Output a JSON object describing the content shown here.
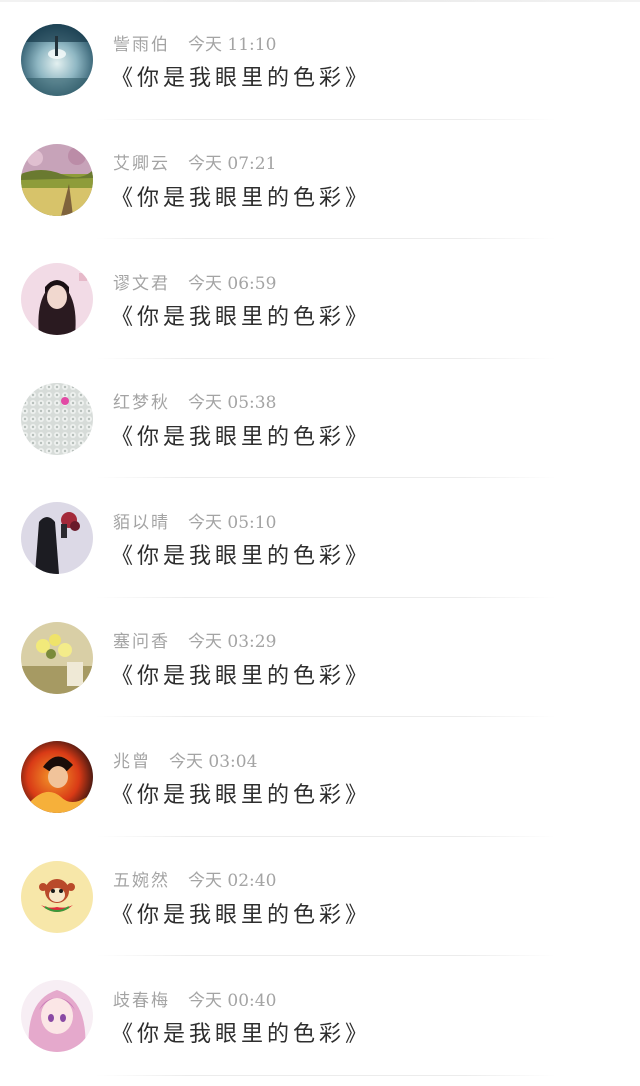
{
  "feed": {
    "items": [
      {
        "name": "訾雨伯",
        "date": "今天",
        "time": "11:10",
        "message": "《你是我眼里的色彩》",
        "avatar": {
          "desc": "ballet-dancer-photo",
          "colors": [
            "#1d4a5e",
            "#8fb7c3",
            "#e3f0f0"
          ]
        }
      },
      {
        "name": "艾卿云",
        "date": "今天",
        "time": "07:21",
        "message": "《你是我眼里的色彩》",
        "avatar": {
          "desc": "blossom-field-photo",
          "colors": [
            "#c7a3b9",
            "#8e9c3a",
            "#d7c36a"
          ]
        }
      },
      {
        "name": "谬文君",
        "date": "今天",
        "time": "06:59",
        "message": "《你是我眼里的色彩》",
        "avatar": {
          "desc": "girl-portrait-photo",
          "colors": [
            "#f2dbe6",
            "#2a1a20",
            "#e6b9c9"
          ]
        }
      },
      {
        "name": "红梦秋",
        "date": "今天",
        "time": "05:38",
        "message": "《你是我眼里的色彩》",
        "avatar": {
          "desc": "knit-texture-photo",
          "colors": [
            "#d7dcd9",
            "#b7bfbb",
            "#e24aa4"
          ]
        }
      },
      {
        "name": "貊以晴",
        "date": "今天",
        "time": "05:10",
        "message": "《你是我眼里的色彩》",
        "avatar": {
          "desc": "person-flowers-photo",
          "colors": [
            "#dcd9e6",
            "#1c1c22",
            "#a32a3a"
          ]
        }
      },
      {
        "name": "塞问香",
        "date": "今天",
        "time": "03:29",
        "message": "《你是我眼里的色彩》",
        "avatar": {
          "desc": "yellow-flowers-photo",
          "colors": [
            "#d9cfa6",
            "#a69a63",
            "#f2ea7a"
          ]
        }
      },
      {
        "name": "兆曾",
        "date": "今天",
        "time": "03:04",
        "message": "《你是我眼里的色彩》",
        "avatar": {
          "desc": "anime-fire-character",
          "colors": [
            "#d93a16",
            "#f49a2a",
            "#2a1210"
          ]
        }
      },
      {
        "name": "五婉然",
        "date": "今天",
        "time": "02:40",
        "message": "《你是我眼里的色彩》",
        "avatar": {
          "desc": "paul-frank-monkey-logo",
          "colors": [
            "#f7e7a9",
            "#b94a2a",
            "#e02a3a"
          ]
        }
      },
      {
        "name": "歧春梅",
        "date": "今天",
        "time": "00:40",
        "message": "《你是我眼里的色彩》",
        "avatar": {
          "desc": "anime-pink-hair-girl",
          "colors": [
            "#f2cde0",
            "#c77ab6",
            "#8a4aa4"
          ]
        }
      }
    ]
  }
}
